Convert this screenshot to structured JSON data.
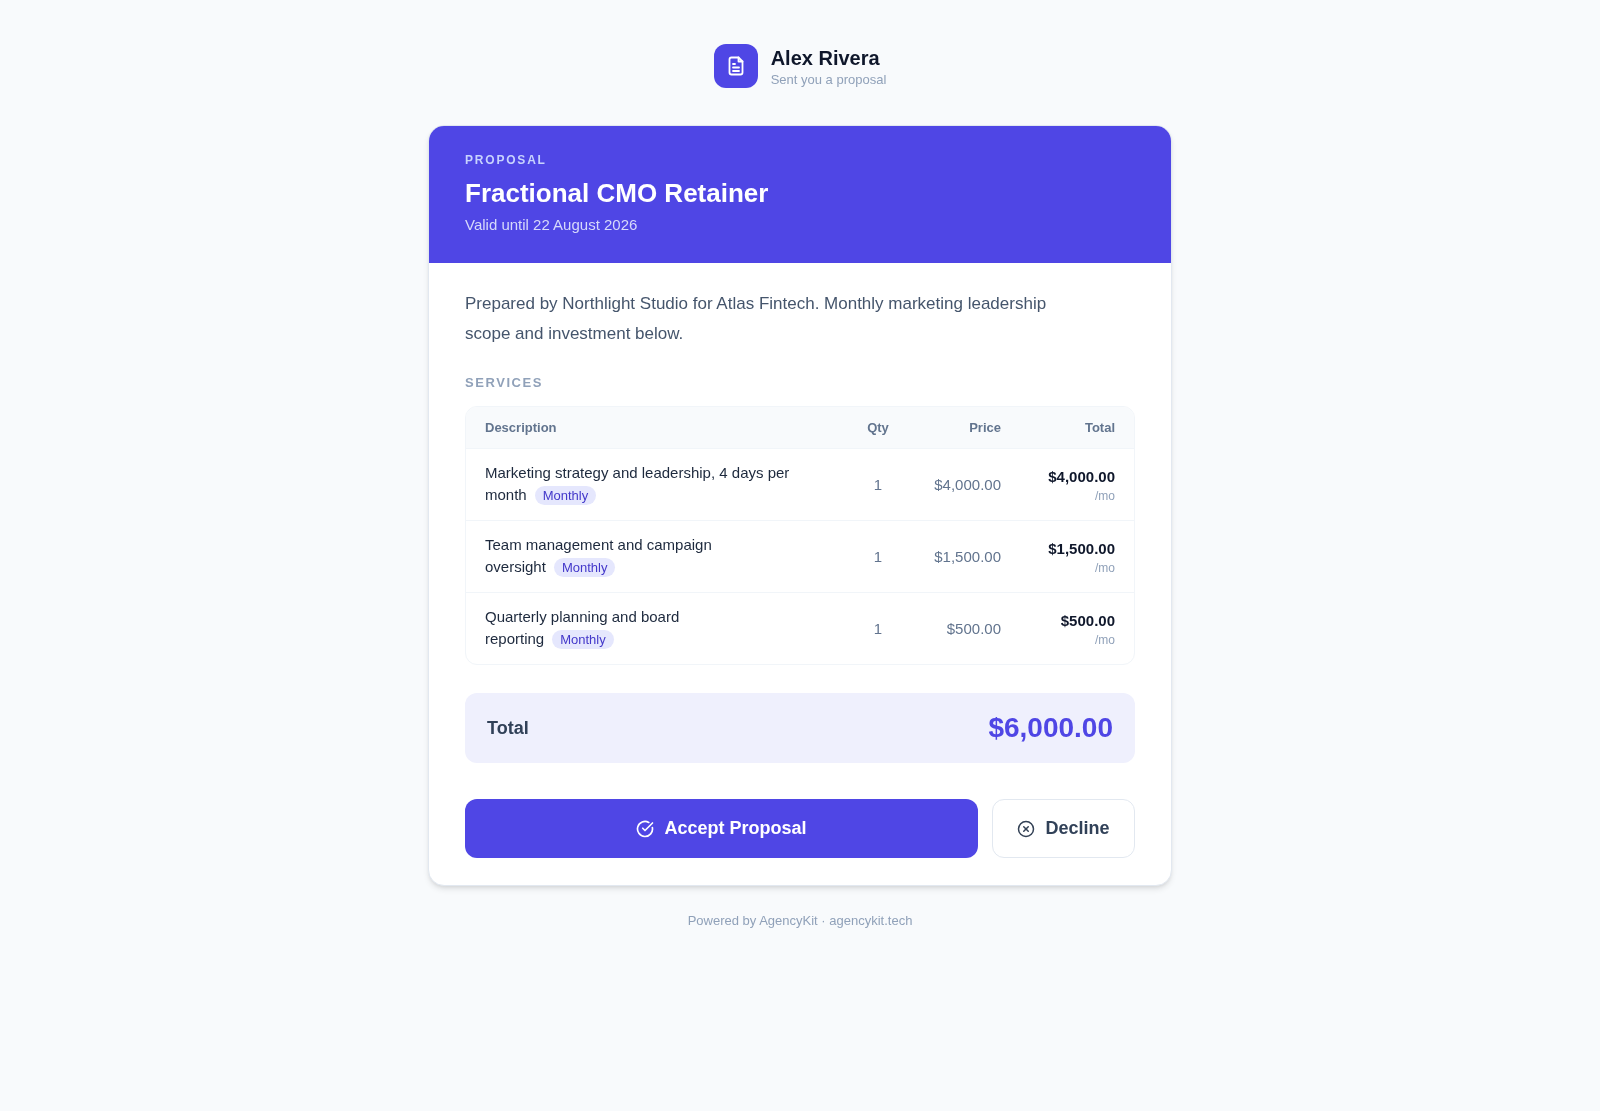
{
  "sender": {
    "name": "Alex Rivera",
    "subtitle": "Sent you a proposal"
  },
  "proposal": {
    "eyebrow": "PROPOSAL",
    "title": "Fractional CMO Retainer",
    "validity": "Valid until 22 August 2026"
  },
  "intro": "Prepared by Northlight Studio for Atlas Fintech. Monthly marketing leadership scope and investment below.",
  "services": {
    "heading": "SERVICES",
    "columns": [
      "Description",
      "Qty",
      "Price",
      "Total"
    ],
    "rows": [
      {
        "description": "Marketing strategy and leadership, 4 days per month",
        "badge": "Monthly",
        "qty": "1",
        "price": "$4,000.00",
        "total": "$4,000.00",
        "unit": "/mo"
      },
      {
        "description": "Team management and campaign oversight",
        "badge": "Monthly",
        "qty": "1",
        "price": "$1,500.00",
        "total": "$1,500.00",
        "unit": "/mo"
      },
      {
        "description": "Quarterly planning and board reporting",
        "badge": "Monthly",
        "qty": "1",
        "price": "$500.00",
        "total": "$500.00",
        "unit": "/mo"
      }
    ]
  },
  "total": {
    "label": "Total",
    "amount": "$6,000.00"
  },
  "actions": [
    {
      "kind": "primary",
      "label": "Accept Proposal"
    },
    {
      "kind": "secondary",
      "label": "Decline"
    }
  ],
  "footer": "Powered by AgencyKit · agencykit.tech"
}
